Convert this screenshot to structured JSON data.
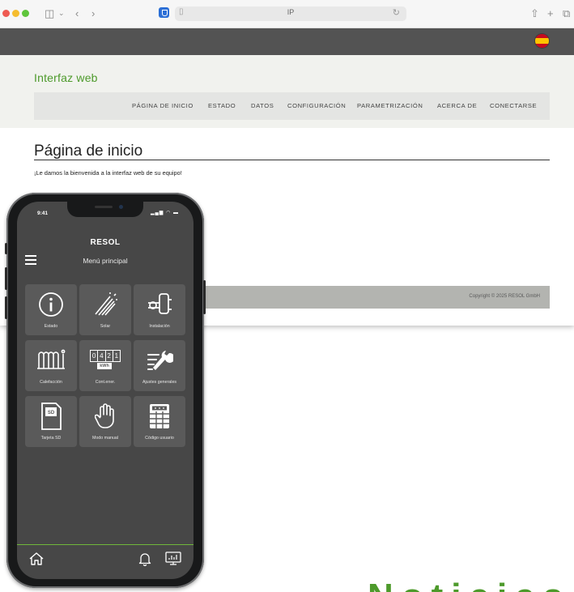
{
  "browser": {
    "address": "IP"
  },
  "site": {
    "brand": "Interfaz web",
    "nav": [
      "PÁGINA DE INICIO",
      "ESTADO",
      "DATOS",
      "CONFIGURACIÓN",
      "PARAMETRIZACIÓN",
      "ACERCA DE",
      "CONECTARSE"
    ],
    "page_title": "Página de inicio",
    "welcome": "¡Le damos la bienvenida a la interfaz web de su equipo!",
    "copyright": "Copyright © 2025 RESOL GmbH"
  },
  "phone": {
    "time": "9:41",
    "logo": "RESOL",
    "menu_title": "Menú principal",
    "tiles": [
      {
        "label": "Estado",
        "icon": "info-icon"
      },
      {
        "label": "Solar",
        "icon": "solar-collector-icon"
      },
      {
        "label": "Instalación",
        "icon": "installation-icon"
      },
      {
        "label": "Calefacción",
        "icon": "radiator-icon"
      },
      {
        "label": "Cont.ener.",
        "icon": "energy-meter-icon"
      },
      {
        "label": "Ajustes generales",
        "icon": "settings-wrench-icon"
      },
      {
        "label": "Tarjeta SD",
        "icon": "sd-card-icon"
      },
      {
        "label": "Modo manual",
        "icon": "hand-icon"
      },
      {
        "label": "Código usuario",
        "icon": "keypad-icon"
      }
    ],
    "meter_digits": [
      "0",
      "4",
      "2",
      "1"
    ],
    "meter_unit": "kWh",
    "accent": "#6fb63a"
  },
  "bottom_fragment": "Noticias"
}
